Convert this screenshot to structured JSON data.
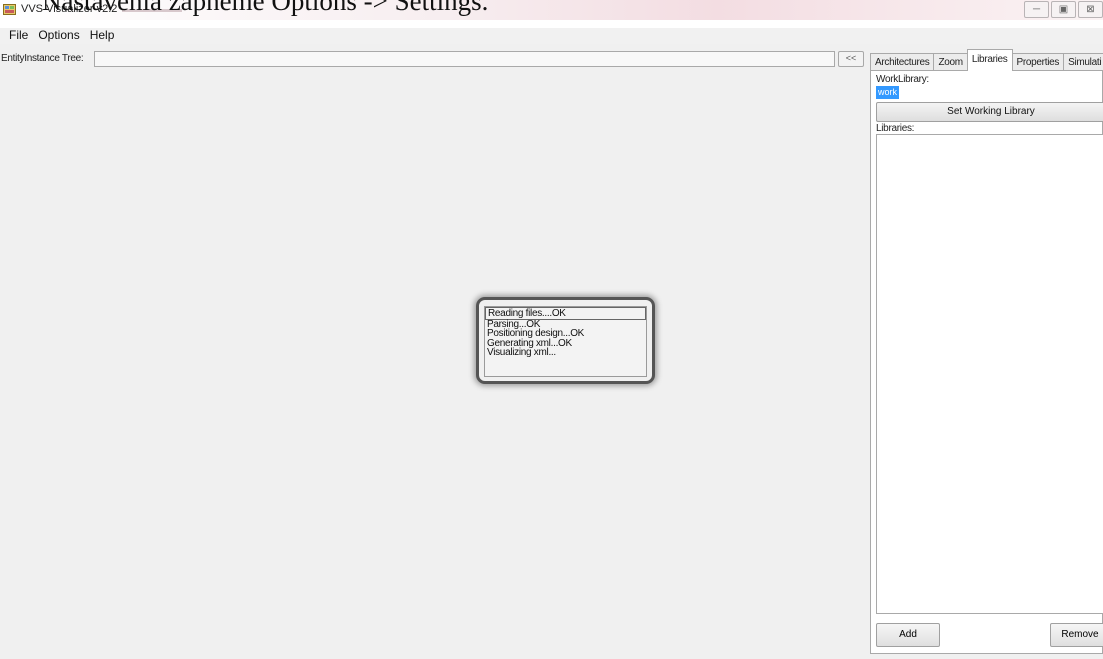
{
  "caption": "Nastavenia zapneme Options -> Settings.",
  "window": {
    "title": "VVS Visualizer v2.2",
    "buttons": [
      "─",
      "▣",
      "⊠"
    ]
  },
  "menu": [
    "File",
    "Options",
    "Help"
  ],
  "toolbar": {
    "tree_label": "EntityInstance Tree:",
    "collapse_label": "<<"
  },
  "panel": {
    "tabs": [
      "Architectures",
      "Zoom",
      "Libraries",
      "Properties",
      "Simulati"
    ],
    "active_tab": "Libraries",
    "work_library_label": "WorkLibrary:",
    "work_library_value": "work",
    "set_working_button": "Set Working Library",
    "libraries_label": "Libraries:",
    "add_button": "Add",
    "remove_button": "Remove"
  },
  "progress": {
    "lines": [
      "Reading files....OK",
      "Parsing...OK",
      "Positioning design...OK",
      "Generating xml...OK",
      "Visualizing xml..."
    ]
  },
  "icons": {
    "app": "app-window-icon"
  }
}
